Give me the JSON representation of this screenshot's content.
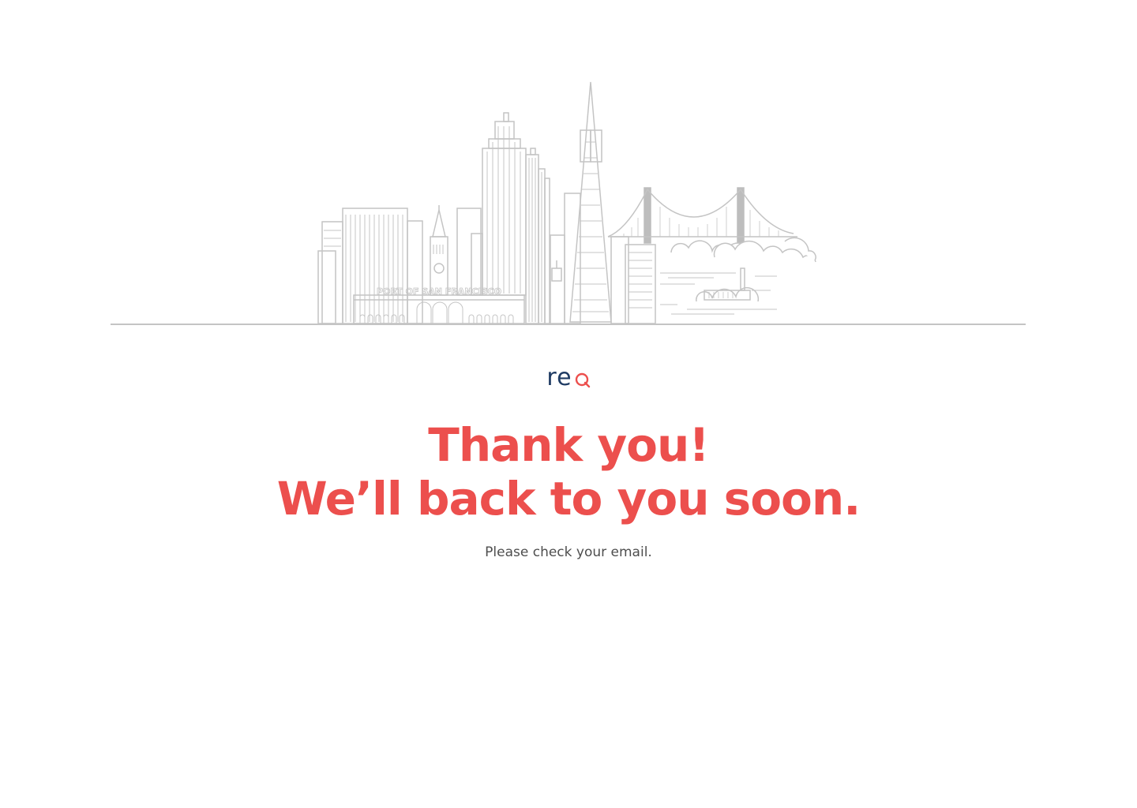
{
  "illustration": {
    "name": "San Francisco skyline",
    "sign_text": "PORT OF SAN FRANCISCO",
    "stroke_color": "#c4c4c4",
    "fill_gray": "#bdbdbd"
  },
  "brand": {
    "logo_letters": "re",
    "logo_letter_accent": "Q",
    "dark_color": "#1f3b63",
    "accent_color": "#ec4f4d"
  },
  "message": {
    "line1": "Thank you!",
    "line2": "We’ll back to you soon.",
    "subtext": "Please check your email."
  },
  "colors": {
    "headline": "#ec4f4d",
    "subtext": "#4e4e4e",
    "background": "#ffffff"
  }
}
